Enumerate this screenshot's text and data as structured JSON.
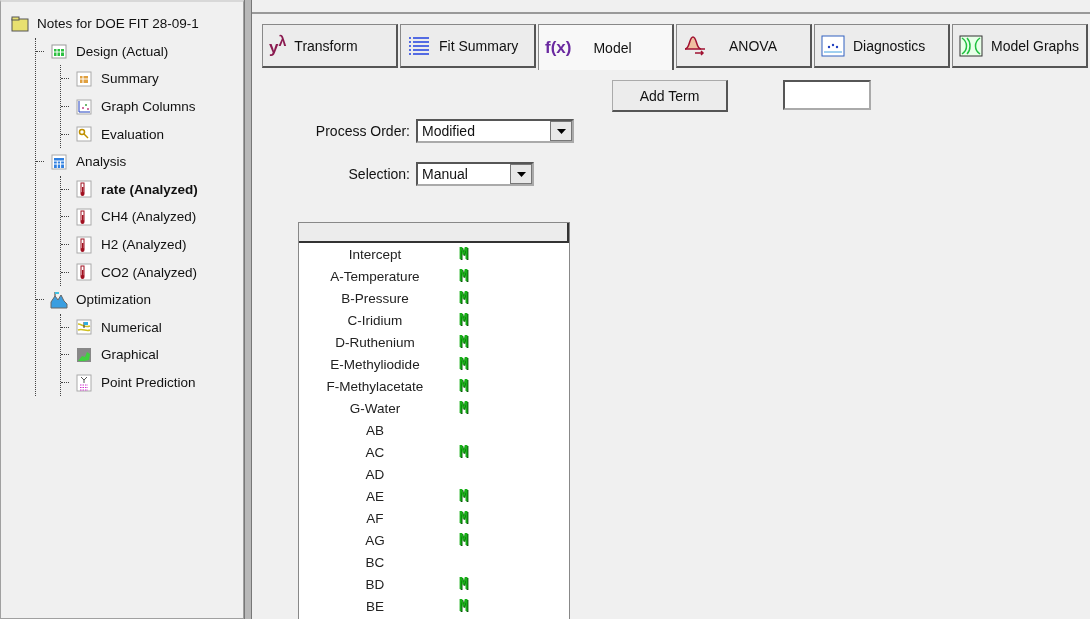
{
  "tree": {
    "label": "Notes for DOE FIT 28-09-1",
    "kind": "folder",
    "selected": false,
    "children": [
      {
        "label": "Design (Actual)",
        "kind": "table",
        "selected": false,
        "children": [
          {
            "label": "Summary",
            "kind": "summary",
            "selected": false
          },
          {
            "label": "Graph Columns",
            "kind": "graph",
            "selected": false
          },
          {
            "label": "Evaluation",
            "kind": "search",
            "selected": false
          }
        ]
      },
      {
        "label": "Analysis",
        "kind": "calculator",
        "selected": false,
        "children": [
          {
            "label": "rate (Analyzed)",
            "kind": "thermometer",
            "selected": true
          },
          {
            "label": "CH4 (Analyzed)",
            "kind": "thermometer",
            "selected": false
          },
          {
            "label": "H2 (Analyzed)",
            "kind": "thermometer",
            "selected": false
          },
          {
            "label": "CO2 (Analyzed)",
            "kind": "thermometer",
            "selected": false
          }
        ]
      },
      {
        "label": "Optimization",
        "kind": "mountain",
        "selected": false,
        "children": [
          {
            "label": "Numerical",
            "kind": "numerical",
            "selected": false
          },
          {
            "label": "Graphical",
            "kind": "graphical",
            "selected": false
          },
          {
            "label": "Point Prediction",
            "kind": "prediction",
            "selected": false
          }
        ]
      }
    ]
  },
  "tabs": [
    {
      "label": "Transform",
      "kind": "transform",
      "icon_text": "y$^{λ}$",
      "selected": false
    },
    {
      "label": "Fit Summary",
      "kind": "list",
      "selected": false
    },
    {
      "label": "Model",
      "kind": "function",
      "icon_text": "f(x)",
      "selected": true
    },
    {
      "label": "ANOVA",
      "kind": "distribution",
      "selected": false
    },
    {
      "label": "Diagnostics",
      "kind": "scatter",
      "selected": false
    },
    {
      "label": "Model Graphs",
      "kind": "contour",
      "selected": false
    }
  ],
  "add_term_button": "Add Term",
  "process_order": {
    "label": "Process Order:",
    "value": "Modified"
  },
  "selection": {
    "label": "Selection:",
    "value": "Manual"
  },
  "terms": [
    {
      "name": "Intercept",
      "mark": "M"
    },
    {
      "name": "A-Temperature",
      "mark": "M"
    },
    {
      "name": "B-Pressure",
      "mark": "M"
    },
    {
      "name": "C-Iridium",
      "mark": "M"
    },
    {
      "name": "D-Ruthenium",
      "mark": "M"
    },
    {
      "name": "E-Methyliodide",
      "mark": "M"
    },
    {
      "name": "F-Methylacetate",
      "mark": "M"
    },
    {
      "name": "G-Water",
      "mark": "M"
    },
    {
      "name": "AB"
    },
    {
      "name": "AC",
      "mark": "M"
    },
    {
      "name": "AD"
    },
    {
      "name": "AE",
      "mark": "M"
    },
    {
      "name": "AF",
      "mark": "M"
    },
    {
      "name": "AG",
      "mark": "M"
    },
    {
      "name": "BC"
    },
    {
      "name": "BD",
      "mark": "M"
    },
    {
      "name": "BE",
      "mark": "M"
    }
  ]
}
